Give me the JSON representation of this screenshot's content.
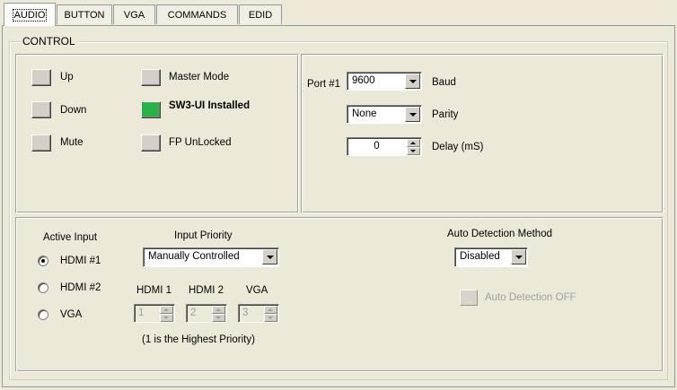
{
  "tabs": [
    {
      "label": "AUDIO",
      "active": true
    },
    {
      "label": "BUTTON",
      "active": false
    },
    {
      "label": "VGA",
      "active": false
    },
    {
      "label": "COMMANDS",
      "active": false
    },
    {
      "label": "EDID",
      "active": false
    }
  ],
  "control": {
    "legend": "CONTROL",
    "status_buttons": [
      {
        "label": "Up",
        "lit": false
      },
      {
        "label": "Down",
        "lit": false
      },
      {
        "label": "Mute",
        "lit": false
      },
      {
        "label": "Master Mode",
        "lit": false
      },
      {
        "label": "SW3-UI Installed",
        "lit": true
      },
      {
        "label": "FP UnLocked",
        "lit": false
      }
    ],
    "led_on_color": "#27b348"
  },
  "serial": {
    "port_label": "Port #1",
    "baud_value": "9600",
    "baud_label": "Baud",
    "parity_value": "None",
    "parity_label": "Parity",
    "delay_value": "0",
    "delay_label": "Delay (mS)"
  },
  "inputs": {
    "active_input_heading": "Active Input",
    "options": [
      {
        "label": "HDMI #1",
        "checked": true
      },
      {
        "label": "HDMI #2",
        "checked": false
      },
      {
        "label": "VGA",
        "checked": false
      }
    ],
    "priority_heading": "Input Priority",
    "priority_mode": "Manually Controlled",
    "priority_columns": [
      {
        "label": "HDMI 1",
        "value": "1"
      },
      {
        "label": "HDMI 2",
        "value": "2"
      },
      {
        "label": "VGA",
        "value": "3"
      }
    ],
    "priority_note": "(1 is the Highest Priority)",
    "auto_heading": "Auto Detection Method",
    "auto_method": "Disabled",
    "auto_status": "Auto Detection OFF"
  }
}
